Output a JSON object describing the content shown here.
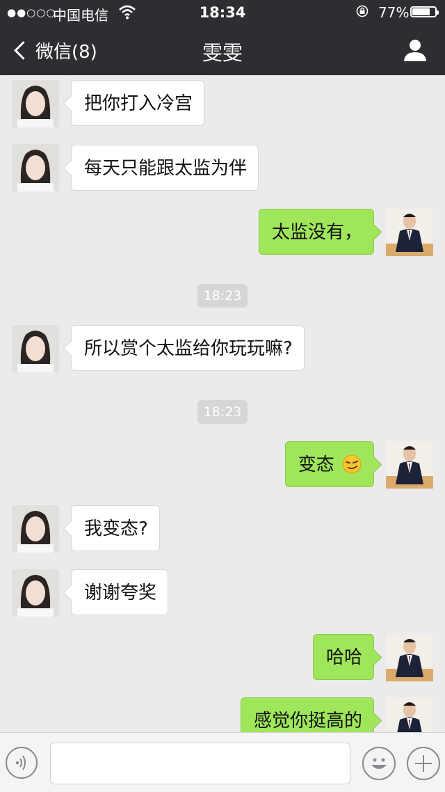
{
  "status_bar": {
    "signal": "●●○○○",
    "carrier": "中国电信",
    "time": "18:34",
    "battery_percent_text": "77%",
    "battery_level": 0.77
  },
  "nav": {
    "back_label": "微信(8)",
    "title": "雯雯"
  },
  "messages": [
    {
      "side": "left",
      "text": "把你打入冷宫"
    },
    {
      "side": "left",
      "text": "每天只能跟太监为伴"
    },
    {
      "side": "right",
      "text": "太监没有，"
    },
    {
      "timestamp": "18:23"
    },
    {
      "side": "left",
      "text": "所以赏个太监给你玩玩嘛?"
    },
    {
      "timestamp": "18:23"
    },
    {
      "side": "right",
      "text": "变态",
      "emoji": "smirk-emoji"
    },
    {
      "side": "left",
      "text": "我变态?"
    },
    {
      "side": "left",
      "text": "谢谢夸奖"
    },
    {
      "side": "right",
      "text": "哈哈"
    },
    {
      "side": "right",
      "text": "感觉你挺高的"
    }
  ],
  "input_bar": {
    "placeholder": "",
    "icons": [
      "voice-icon",
      "emoji-icon",
      "plus-icon"
    ]
  },
  "colors": {
    "header_bg": "#2e2e32",
    "chat_bg": "#ebebeb",
    "outgoing_bubble": "#9fe65b",
    "incoming_bubble": "#ffffff"
  }
}
